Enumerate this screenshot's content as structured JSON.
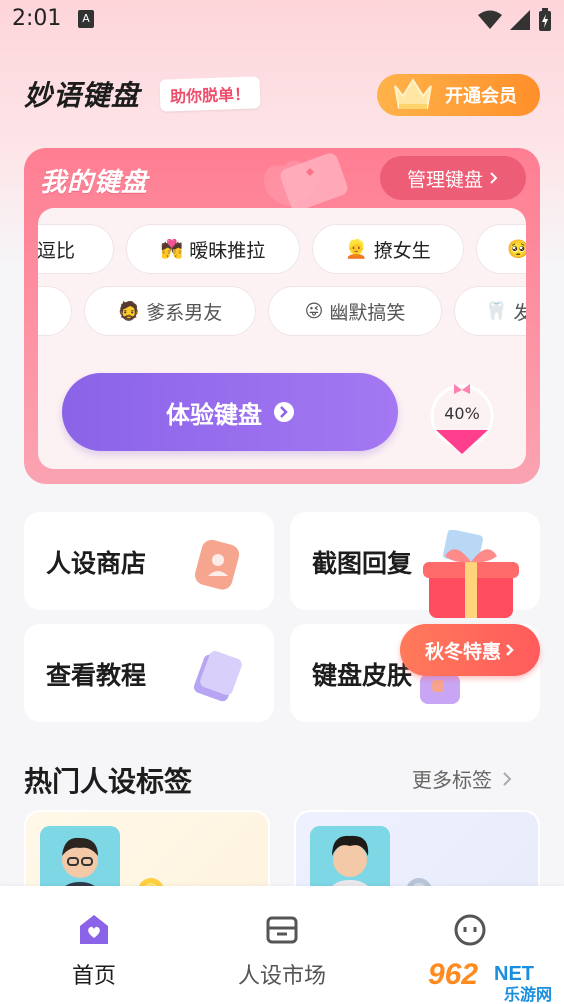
{
  "status_bar": {
    "time": "2:01",
    "notification_letter": "A"
  },
  "header": {
    "app_title": "妙语键盘",
    "slogan": "助你脱单！",
    "vip_label": "开通会员"
  },
  "keyboard_card": {
    "title": "我的键盘",
    "manage_label": "管理键盘",
    "tags_row1": [
      {
        "emoji": "",
        "label": "逗比"
      },
      {
        "emoji": "💏",
        "label": "暧昧推拉"
      },
      {
        "emoji": "👱",
        "label": "撩女生"
      },
      {
        "emoji": "🥺",
        "label": ""
      }
    ],
    "tags_row2": [
      {
        "emoji": "",
        "label": ""
      },
      {
        "emoji": "🧔",
        "label": "爹系男友"
      },
      {
        "emoji": "😜",
        "label": "幽默搞笑"
      },
      {
        "emoji": "🦷",
        "label": "发"
      }
    ],
    "try_label": "体验键盘",
    "progress_text": "40%",
    "progress_value": 0.4
  },
  "tiles": [
    {
      "label": "人设商店",
      "icon": "tag-icon"
    },
    {
      "label": "截图回复",
      "icon": "screenshot-icon"
    },
    {
      "label": "查看教程",
      "icon": "book-icon"
    },
    {
      "label": "键盘皮肤",
      "icon": "skin-icon"
    }
  ],
  "promo": {
    "label": "秋冬特惠"
  },
  "hot_section": {
    "title": "热门人设标签",
    "more_label": "更多标签"
  },
  "bottom_nav": [
    {
      "label": "首页",
      "icon": "home-icon",
      "active": true
    },
    {
      "label": "人设市场",
      "icon": "market-icon",
      "active": false
    },
    {
      "label": "",
      "icon": "chat-face-icon",
      "active": false
    }
  ],
  "watermark": {
    "number": "962",
    "suffix": "NET",
    "site": "乐游网"
  },
  "colors": {
    "accent_purple": "#8a63e8",
    "pink": "#ff7e92",
    "orange": "#ff8f2a"
  }
}
